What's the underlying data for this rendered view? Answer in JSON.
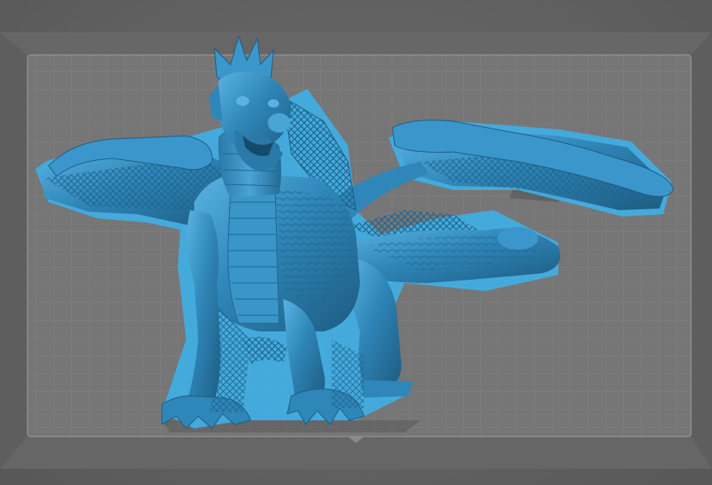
{
  "viewport": {
    "background_color": "#636363",
    "plate_color": "#7a7a7a",
    "grid_color": "#878787",
    "model_color": "#2f86b8",
    "model_highlight_color": "#5ab3e3",
    "model_shadow_color": "#1d5c82",
    "support_outline_color": "#3fb0e8"
  }
}
